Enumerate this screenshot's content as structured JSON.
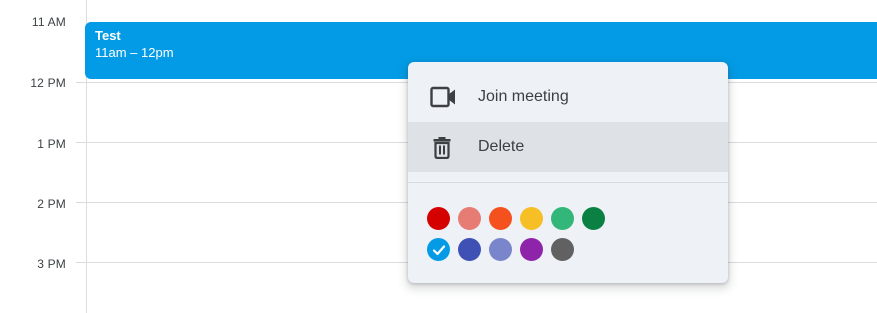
{
  "time_gutter": {
    "labels": [
      "11 AM",
      "12 PM",
      "1 PM",
      "2 PM",
      "3 PM"
    ]
  },
  "event": {
    "title": "Test",
    "time": "11am – 12pm",
    "color": "#039be5"
  },
  "context_menu": {
    "items": [
      {
        "label": "Join meeting",
        "icon": "video-camera-icon"
      },
      {
        "label": "Delete",
        "icon": "trash-icon"
      }
    ],
    "highlighted_item": "Delete",
    "colors": {
      "row1": [
        "#d50000",
        "#e67c73",
        "#f4511e",
        "#f6bf26",
        "#33b679",
        "#0b8043"
      ],
      "row2": [
        "#039be5",
        "#3f51b5",
        "#7986cb",
        "#8e24aa",
        "#616161"
      ]
    },
    "selected_color": "#039be5"
  }
}
